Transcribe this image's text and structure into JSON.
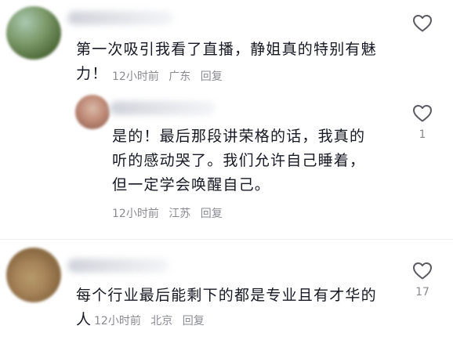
{
  "comments": [
    {
      "text_line1": "第一次吸引我看了直播，静姐真的特别有魅",
      "text_line2": "力！",
      "time": "12小时前",
      "location": "广东",
      "reply_label": "回复",
      "like_icon": "heart-outline-icon",
      "likes": ""
    },
    {
      "text_line1": "是的！最后那段讲荣格的话，我真的",
      "text_line2": "听的感动哭了。我们允许自己睡着，",
      "text_line3": "但一定学会唤醒自己。",
      "time": "12小时前",
      "location": "江苏",
      "reply_label": "回复",
      "like_icon": "heart-outline-icon",
      "likes": "1"
    },
    {
      "text_line1": "每个行业最后能剩下的都是专业且有才华的",
      "text_line2": "人",
      "time": "12小时前",
      "location": "北京",
      "reply_label": "回复",
      "like_icon": "heart-outline-icon",
      "likes": "17"
    }
  ],
  "colors": {
    "text": "#161823",
    "meta": "#8a8b91",
    "icon": "#5a5b62"
  }
}
